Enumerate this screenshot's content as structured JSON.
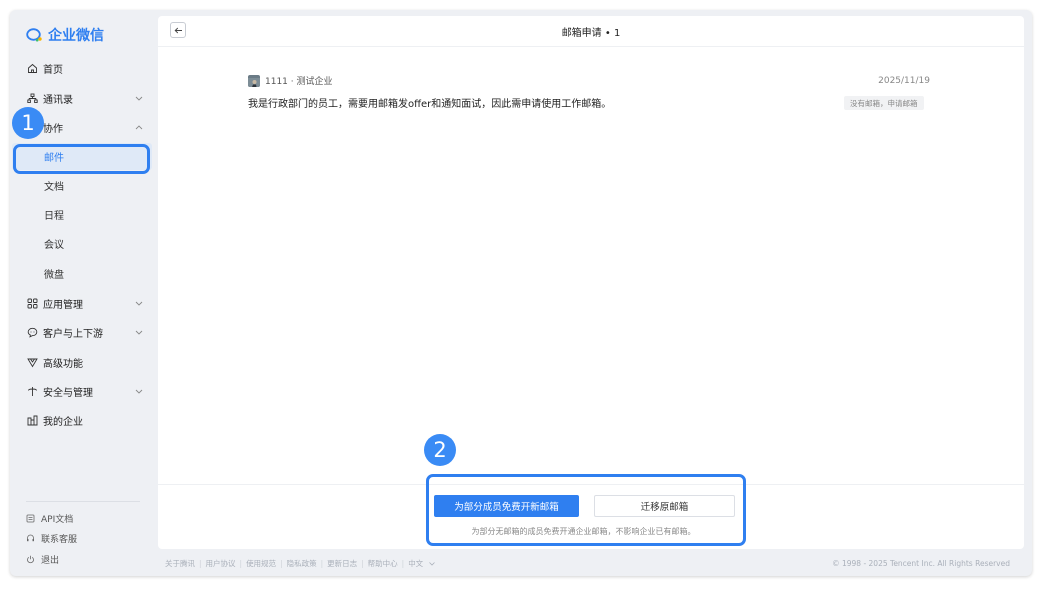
{
  "brand": {
    "name": "企业微信"
  },
  "nav": [
    {
      "icon": "home-icon",
      "label": "首页"
    },
    {
      "icon": "contacts-icon",
      "label": "通讯录"
    },
    {
      "icon": "collab-icon",
      "label": "协作"
    },
    {
      "icon": "apps-icon",
      "label": "应用管理"
    },
    {
      "icon": "customer-icon",
      "label": "客户与上下游"
    },
    {
      "icon": "advanced-icon",
      "label": "高级功能"
    },
    {
      "icon": "security-icon",
      "label": "安全与管理"
    },
    {
      "icon": "company-icon",
      "label": "我的企业"
    }
  ],
  "subnav": [
    "邮件",
    "文档",
    "日程",
    "会议",
    "微盘"
  ],
  "sidebar_footer": [
    {
      "icon": "api-doc-icon",
      "label": "API文档"
    },
    {
      "icon": "support-icon",
      "label": "联系客服"
    },
    {
      "icon": "power-icon",
      "label": "退出"
    }
  ],
  "header": {
    "title": "邮箱申请 • 1"
  },
  "message": {
    "sender": "1111 · 测试企业",
    "date": "2025/11/19",
    "text": "我是行政部门的员工，需要用邮箱发offer和通知面试，因此需申请使用工作邮箱。",
    "tag": "没有邮箱，申请邮箱"
  },
  "actions": {
    "primary": "为部分成员免费开新邮箱",
    "secondary": "迁移原邮箱",
    "note": "为部分无邮箱的成员免费开通企业邮箱，不影响企业已有邮箱。"
  },
  "footer": {
    "links": [
      "关于腾讯",
      "用户协议",
      "使用规范",
      "隐私政策",
      "更新日志",
      "帮助中心",
      "中文"
    ],
    "copyright": "© 1998 - 2025 Tencent Inc. All Rights Reserved"
  },
  "annotations": [
    "1",
    "2"
  ],
  "colors": {
    "accent": "#2f7ff0",
    "sidebar_bg": "#eef0f4",
    "active_bg": "#dfe9f7"
  }
}
